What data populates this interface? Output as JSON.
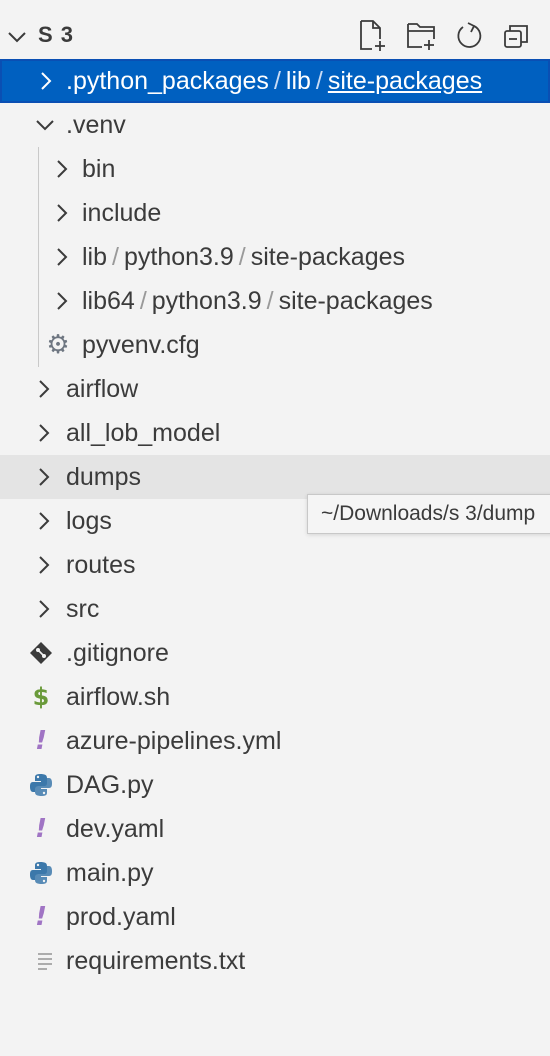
{
  "colors": {
    "selection_bg": "#0060c0",
    "hover_bg": "#e4e4e4",
    "panel_bg": "#f3f3f3",
    "git_icon": "#3b3b3b",
    "shell_icon": "#6a9a3a",
    "yaml_icon": "#a074c4",
    "python_blue": "#3c78aa",
    "python_yellow": "#e0c050"
  },
  "header": {
    "title": "S 3",
    "actions": [
      "new-file-icon",
      "new-folder-icon",
      "refresh-icon",
      "collapse-all-icon"
    ]
  },
  "tree": {
    "row_python_packages": {
      "p1": ".python_packages",
      "p2": "lib",
      "p3": "site-packages",
      "sep": "/"
    },
    "row_venv": {
      "label": ".venv"
    },
    "row_bin": {
      "label": "bin"
    },
    "row_include": {
      "label": "include"
    },
    "row_lib": {
      "p1": "lib",
      "p2": "python3.9",
      "p3": "site-packages",
      "sep": "/"
    },
    "row_lib64": {
      "p1": "lib64",
      "p2": "python3.9",
      "p3": "site-packages",
      "sep": "/"
    },
    "row_pyvenv": {
      "label": "pyvenv.cfg",
      "icon": "gear-icon"
    },
    "folders": {
      "airflow": "airflow",
      "all_lob_model": "all_lob_model",
      "dumps": "dumps",
      "logs": "logs",
      "routes": "routes",
      "src": "src"
    },
    "files": {
      "gitignore": {
        "label": ".gitignore",
        "icon": "git-icon",
        "glyph": "◆"
      },
      "airflow_sh": {
        "label": "airflow.sh",
        "icon": "shell-icon",
        "glyph": "$"
      },
      "azure": {
        "label": "azure-pipelines.yml",
        "icon": "yaml-icon",
        "glyph": "!"
      },
      "dag": {
        "label": "DAG.py",
        "icon": "python-icon"
      },
      "dev": {
        "label": "dev.yaml",
        "icon": "yaml-icon",
        "glyph": "!"
      },
      "main": {
        "label": "main.py",
        "icon": "python-icon"
      },
      "prod": {
        "label": "prod.yaml",
        "icon": "yaml-icon",
        "glyph": "!"
      },
      "requirements": {
        "label": "requirements.txt",
        "icon": "text-file-icon"
      }
    }
  },
  "tooltip": {
    "text": "~/Downloads/s 3/dump"
  }
}
